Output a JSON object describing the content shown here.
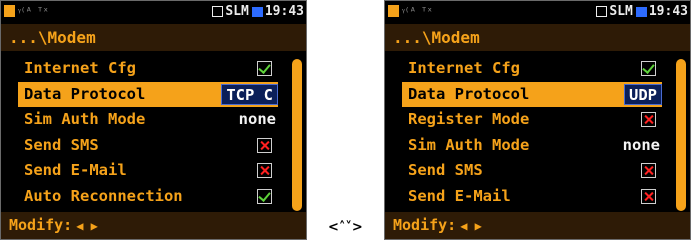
{
  "screens": {
    "left": {
      "status": {
        "mem_icon": "memory-icon",
        "signal": "ᵞ⁽ᴬ ᵀˣ",
        "mode": "SLM",
        "time": "19:43"
      },
      "title": "...\\Modem",
      "items": [
        {
          "label": "Internet Cfg",
          "control": "checkbox",
          "checked": true
        },
        {
          "label": "Data Protocol",
          "control": "value-edit",
          "value": "TCP C",
          "selected": true
        },
        {
          "label": "Sim Auth Mode",
          "control": "value",
          "value": "none"
        },
        {
          "label": "Send SMS",
          "control": "checkbox",
          "checked": false
        },
        {
          "label": "Send E-Mail",
          "control": "checkbox",
          "checked": false
        },
        {
          "label": "Auto Reconnection",
          "control": "checkbox",
          "checked": true
        }
      ],
      "footer": {
        "label": "Modify:",
        "arrows": "◀ ▶"
      }
    },
    "right": {
      "status": {
        "mem_icon": "memory-icon",
        "signal": "ᵞ⁽ᴬ ᵀˣ",
        "mode": "SLM",
        "time": "19:43"
      },
      "title": "...\\Modem",
      "items": [
        {
          "label": "Internet Cfg",
          "control": "checkbox",
          "checked": true
        },
        {
          "label": "Data Protocol",
          "control": "value-edit",
          "value": "UDP",
          "selected": true
        },
        {
          "label": "Register Mode",
          "control": "checkbox",
          "checked": false
        },
        {
          "label": "Sim Auth Mode",
          "control": "value",
          "value": "none"
        },
        {
          "label": "Send SMS",
          "control": "checkbox",
          "checked": false
        },
        {
          "label": "Send E-Mail",
          "control": "checkbox",
          "checked": false
        }
      ],
      "footer": {
        "label": "Modify:",
        "arrows": "◀ ▶"
      }
    }
  },
  "nav_hint": "<˄˅>",
  "colors": {
    "accent": "#f5a21a",
    "title_bg": "#2e1b06",
    "value_box": "#0b1f59",
    "check_on": "#5ed23a",
    "check_off": "#ff2020"
  }
}
